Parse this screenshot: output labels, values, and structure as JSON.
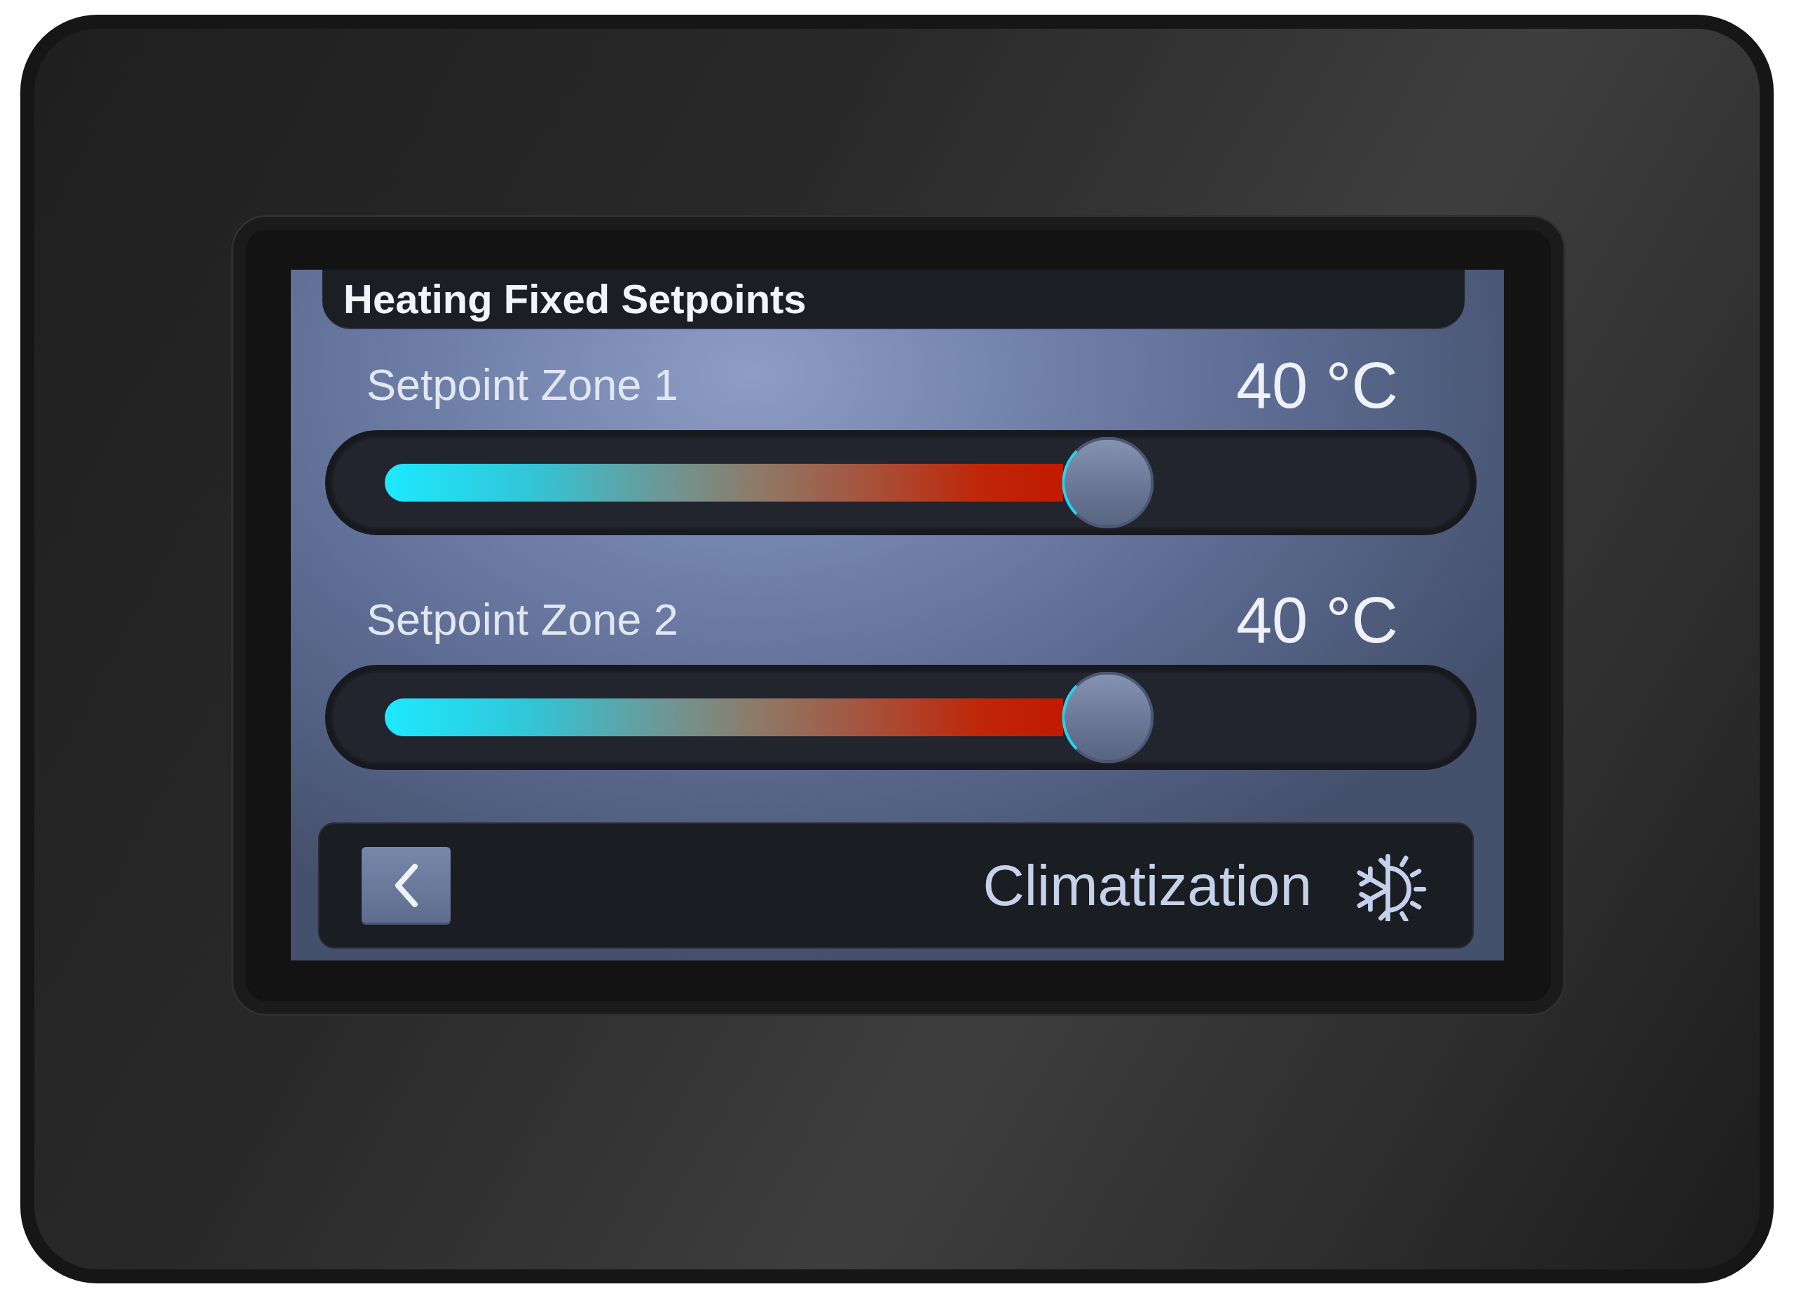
{
  "header": {
    "title": "Heating Fixed Setpoints"
  },
  "setpoints": [
    {
      "label": "Setpoint Zone 1",
      "reading": "40 °C",
      "level": 0.68
    },
    {
      "label": "Setpoint Zone 2",
      "reading": "40 °C",
      "level": 0.68
    }
  ],
  "footer": {
    "title": "Climatization"
  }
}
